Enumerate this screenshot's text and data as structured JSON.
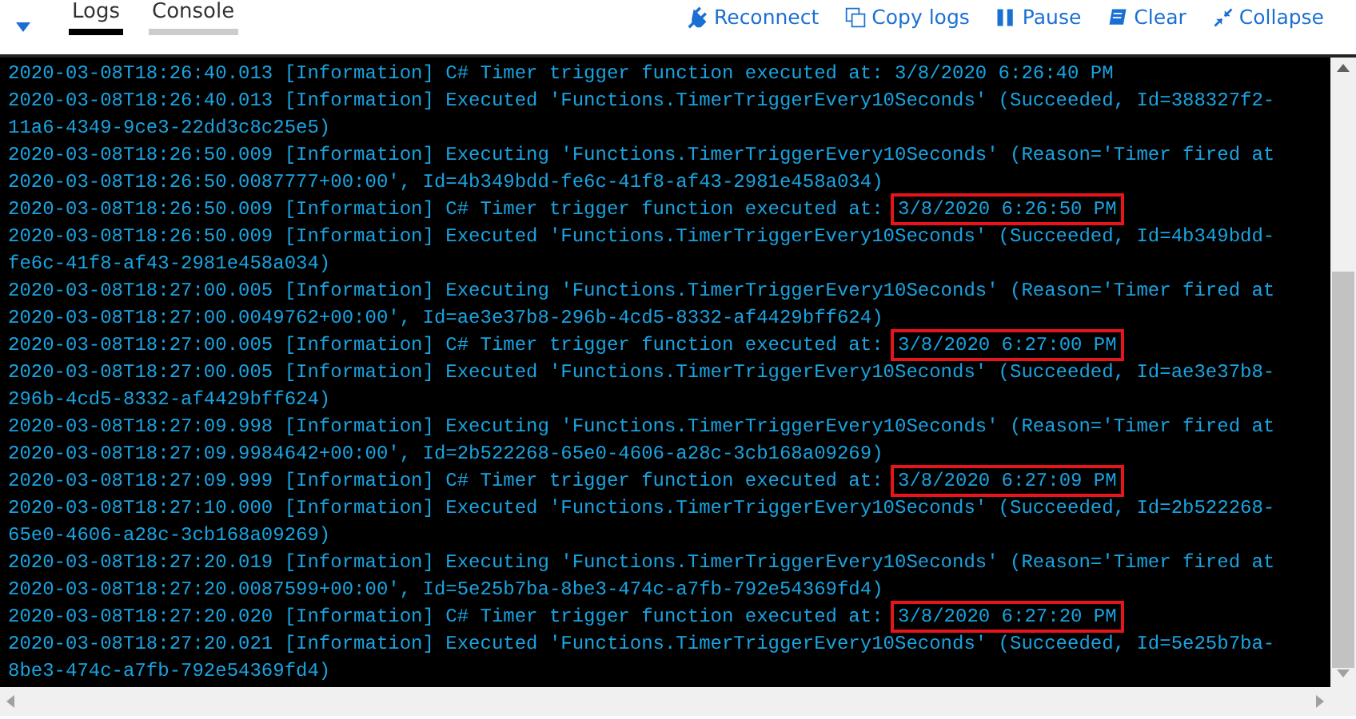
{
  "toolbar": {
    "tabs": [
      {
        "label": "Logs",
        "selected": true
      },
      {
        "label": "Console",
        "selected": false
      }
    ],
    "actions": [
      {
        "kind": "plug",
        "label": "Reconnect"
      },
      {
        "kind": "copy",
        "label": "Copy logs"
      },
      {
        "kind": "pause",
        "label": "Pause"
      },
      {
        "kind": "clear",
        "label": "Clear"
      },
      {
        "kind": "collapse",
        "label": "Collapse"
      }
    ]
  },
  "log_lines": [
    {
      "text": "2020-03-08T18:26:40.013 [Information] C# Timer trigger function executed at: 3/8/2020 6:26:40 PM"
    },
    {
      "text": "2020-03-08T18:26:40.013 [Information] Executed 'Functions.TimerTriggerEvery10Seconds' (Succeeded, Id=388327f2-11a6-4349-9ce3-22dd3c8c25e5)"
    },
    {
      "text": "2020-03-08T18:26:50.009 [Information] Executing 'Functions.TimerTriggerEvery10Seconds' (Reason='Timer fired at 2020-03-08T18:26:50.0087777+00:00', Id=4b349bdd-fe6c-41f8-af43-2981e458a034)"
    },
    {
      "text": "2020-03-08T18:26:50.009 [Information] C# Timer trigger function executed at: ",
      "highlighted": "3/8/2020 6:26:50 PM"
    },
    {
      "text": "2020-03-08T18:26:50.009 [Information] Executed 'Functions.TimerTriggerEvery10Seconds' (Succeeded, Id=4b349bdd-fe6c-41f8-af43-2981e458a034)"
    },
    {
      "text": "2020-03-08T18:27:00.005 [Information] Executing 'Functions.TimerTriggerEvery10Seconds' (Reason='Timer fired at 2020-03-08T18:27:00.0049762+00:00', Id=ae3e37b8-296b-4cd5-8332-af4429bff624)"
    },
    {
      "text": "2020-03-08T18:27:00.005 [Information] C# Timer trigger function executed at: ",
      "highlighted": "3/8/2020 6:27:00 PM"
    },
    {
      "text": "2020-03-08T18:27:00.005 [Information] Executed 'Functions.TimerTriggerEvery10Seconds' (Succeeded, Id=ae3e37b8-296b-4cd5-8332-af4429bff624)"
    },
    {
      "text": "2020-03-08T18:27:09.998 [Information] Executing 'Functions.TimerTriggerEvery10Seconds' (Reason='Timer fired at 2020-03-08T18:27:09.9984642+00:00', Id=2b522268-65e0-4606-a28c-3cb168a09269)"
    },
    {
      "text": "2020-03-08T18:27:09.999 [Information] C# Timer trigger function executed at: ",
      "highlighted": "3/8/2020 6:27:09 PM"
    },
    {
      "text": "2020-03-08T18:27:10.000 [Information] Executed 'Functions.TimerTriggerEvery10Seconds' (Succeeded, Id=2b522268-65e0-4606-a28c-3cb168a09269)"
    },
    {
      "text": "2020-03-08T18:27:20.019 [Information] Executing 'Functions.TimerTriggerEvery10Seconds' (Reason='Timer fired at 2020-03-08T18:27:20.0087599+00:00', Id=5e25b7ba-8be3-474c-a7fb-792e54369fd4)"
    },
    {
      "text": "2020-03-08T18:27:20.020 [Information] C# Timer trigger function executed at: ",
      "highlighted": "3/8/2020 6:27:20 PM"
    },
    {
      "text": "2020-03-08T18:27:20.021 [Information] Executed 'Functions.TimerTriggerEvery10Seconds' (Succeeded, Id=5e25b7ba-8be3-474c-a7fb-792e54369fd4)"
    }
  ]
}
